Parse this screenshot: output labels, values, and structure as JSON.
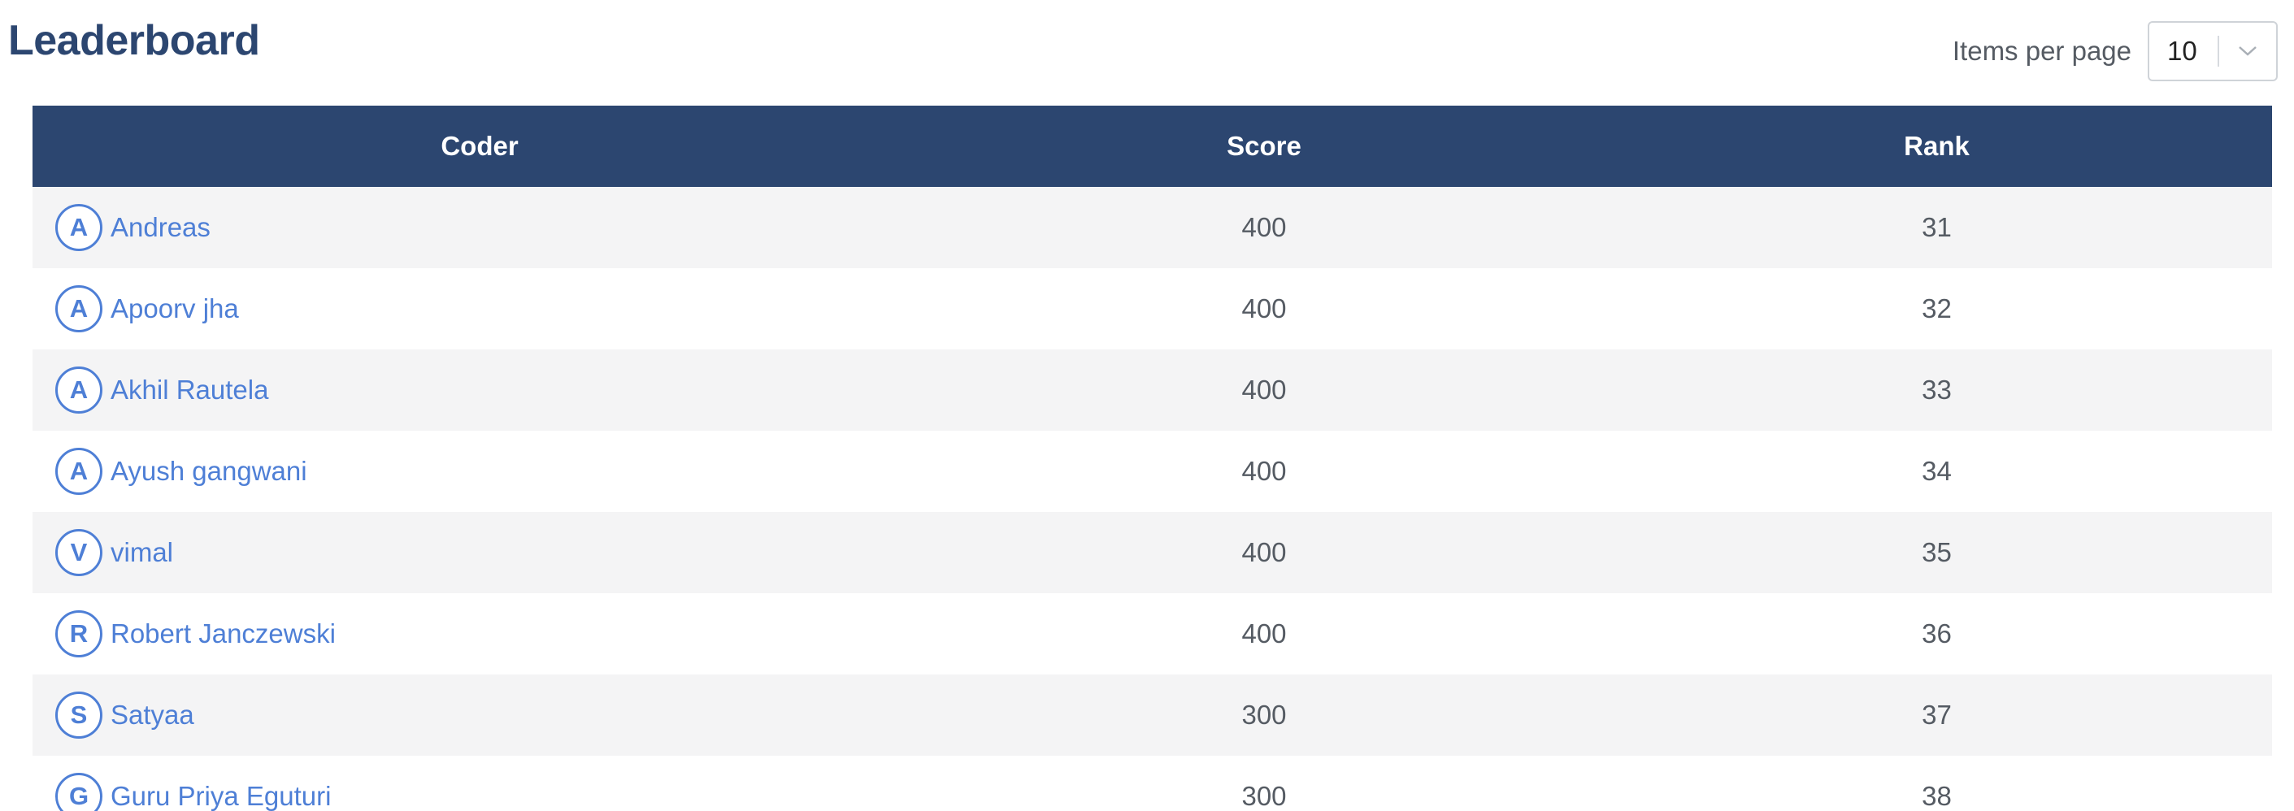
{
  "page": {
    "title": "Leaderboard"
  },
  "pagination": {
    "label": "Items per page",
    "selected": "10",
    "chevron_icon": "chevron-down-icon"
  },
  "table": {
    "headers": {
      "coder": "Coder",
      "score": "Score",
      "rank": "Rank"
    },
    "rows": [
      {
        "initial": "A",
        "name": "Andreas",
        "score": "400",
        "rank": "31"
      },
      {
        "initial": "A",
        "name": "Apoorv jha",
        "score": "400",
        "rank": "32"
      },
      {
        "initial": "A",
        "name": "Akhil Rautela",
        "score": "400",
        "rank": "33"
      },
      {
        "initial": "A",
        "name": "Ayush gangwani",
        "score": "400",
        "rank": "34"
      },
      {
        "initial": "V",
        "name": "vimal",
        "score": "400",
        "rank": "35"
      },
      {
        "initial": "R",
        "name": "Robert Janczewski",
        "score": "400",
        "rank": "36"
      },
      {
        "initial": "S",
        "name": "Satyaa",
        "score": "300",
        "rank": "37"
      },
      {
        "initial": "G",
        "name": "Guru Priya Eguturi",
        "score": "300",
        "rank": "38"
      }
    ]
  },
  "colors": {
    "header_bg": "#2c4670",
    "accent": "#4e7fd6",
    "row_alt": "#f4f4f5"
  }
}
